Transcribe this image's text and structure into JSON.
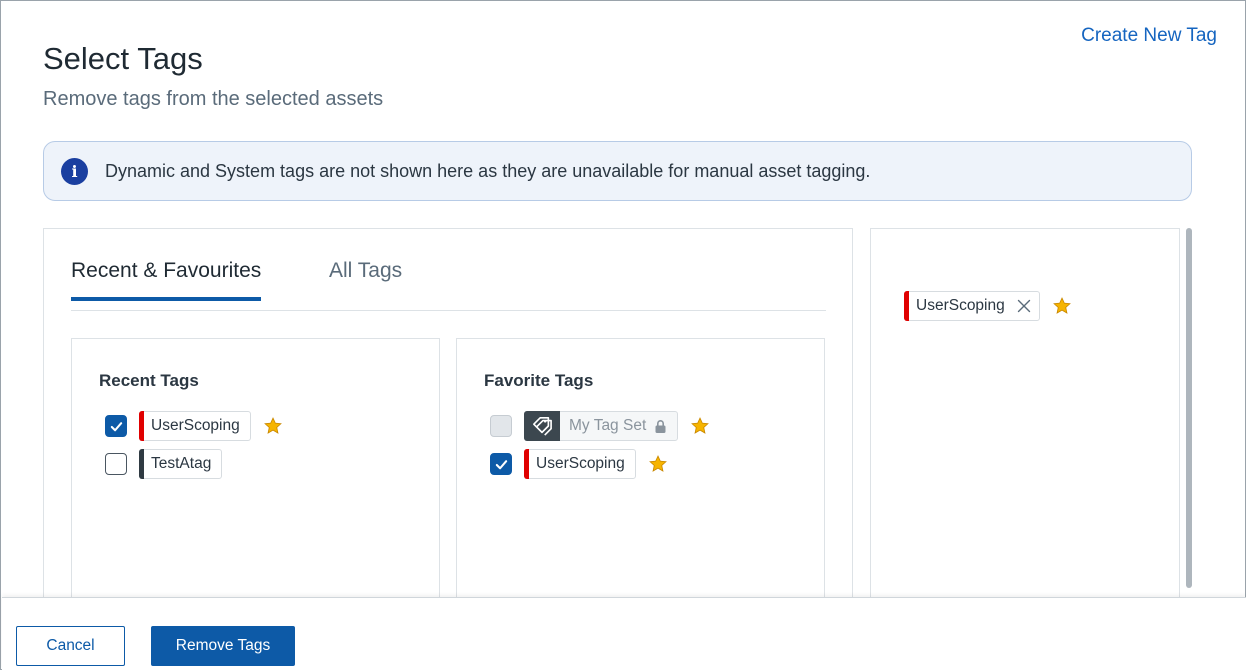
{
  "header": {
    "title": "Select Tags",
    "subtitle": "Remove tags from the selected assets",
    "create_link": "Create New Tag"
  },
  "info_banner": {
    "icon": "info-icon",
    "text": "Dynamic and System tags are not shown here as they are unavailable for manual asset tagging."
  },
  "tabs": [
    {
      "label": "Recent & Favourites",
      "active": true
    },
    {
      "label": "All Tags",
      "active": false
    }
  ],
  "recent_tags": {
    "heading": "Recent Tags",
    "items": [
      {
        "label": "UserScoping",
        "checked": true,
        "favorite": true,
        "color": "#e00000"
      },
      {
        "label": "TestAtag",
        "checked": false,
        "favorite": false,
        "color": "#2f3a42"
      }
    ]
  },
  "favorite_tags": {
    "heading": "Favorite Tags",
    "items": [
      {
        "label": "My Tag Set",
        "checked": false,
        "disabled": true,
        "locked": true,
        "favorite": true,
        "icon": "tag-set-icon"
      },
      {
        "label": "UserScoping",
        "checked": true,
        "favorite": true,
        "color": "#e00000"
      }
    ]
  },
  "selected_tags": [
    {
      "label": "UserScoping",
      "favorite": true,
      "color": "#e00000"
    }
  ],
  "footer": {
    "cancel_label": "Cancel",
    "primary_label": "Remove Tags"
  },
  "colors": {
    "accent": "#0d5aa7",
    "star": "#f6b400",
    "info": "#1a3fa0"
  }
}
